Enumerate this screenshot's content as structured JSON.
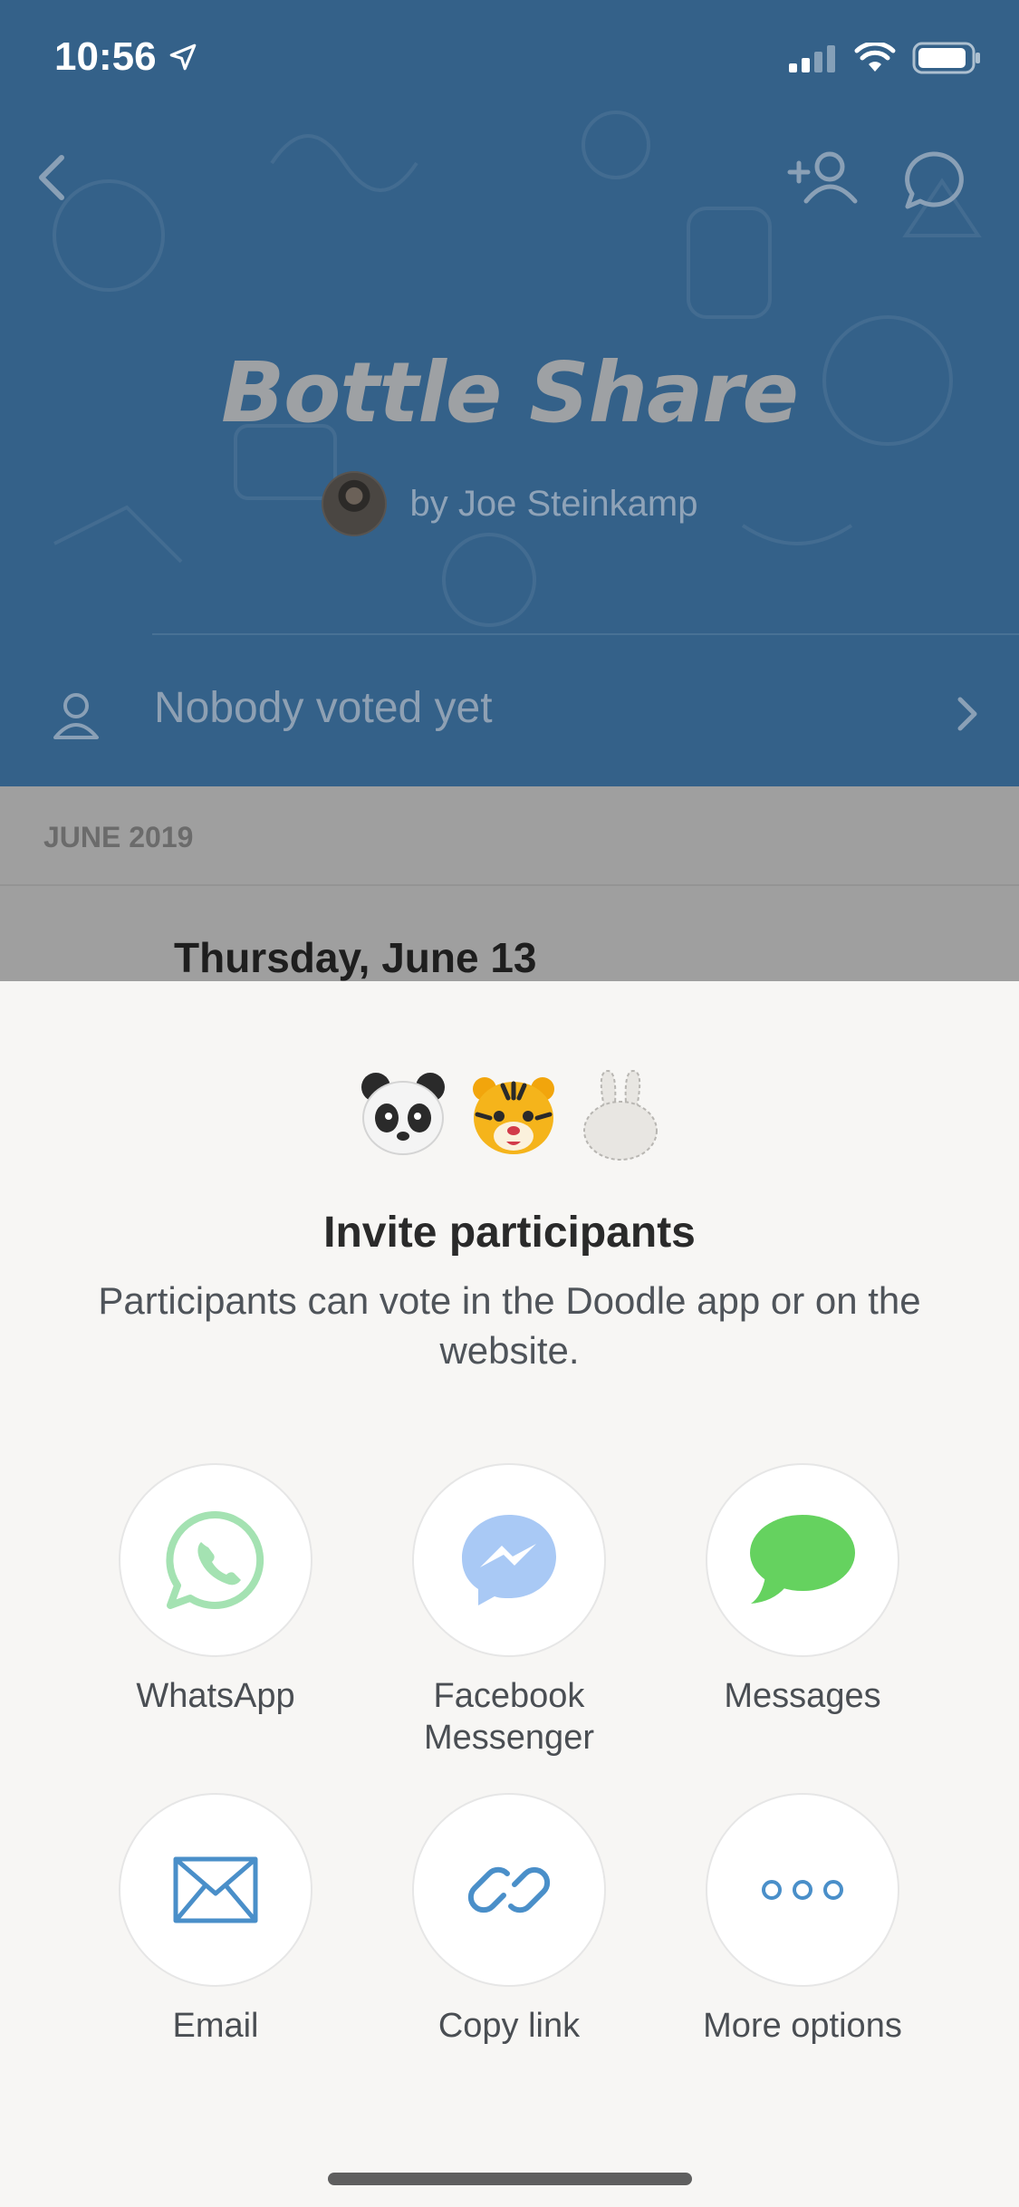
{
  "status_bar": {
    "time": "10:56"
  },
  "header": {
    "title": "Bottle Share",
    "byline": "by Joe Steinkamp",
    "votes_label": "Nobody voted yet",
    "background_color": "#346189"
  },
  "calendar": {
    "month": "JUNE 2019",
    "day": "Thursday, June 13"
  },
  "sheet": {
    "title": "Invite participants",
    "description": "Participants can vote in the Doodle app or on the website.",
    "options": [
      {
        "label": "WhatsApp",
        "icon": "whatsapp-icon",
        "color": "#5fd37a"
      },
      {
        "label": "Facebook\nMessenger",
        "icon": "messenger-icon",
        "color": "#3b8ff5"
      },
      {
        "label": "Messages",
        "icon": "messages-icon",
        "color": "#65d25f"
      },
      {
        "label": "Email",
        "icon": "email-icon",
        "color": "#4a8fc9"
      },
      {
        "label": "Copy link",
        "icon": "link-icon",
        "color": "#4a8fc9"
      },
      {
        "label": "More options",
        "icon": "more-options-icon",
        "color": "#4a8fc9"
      }
    ]
  }
}
